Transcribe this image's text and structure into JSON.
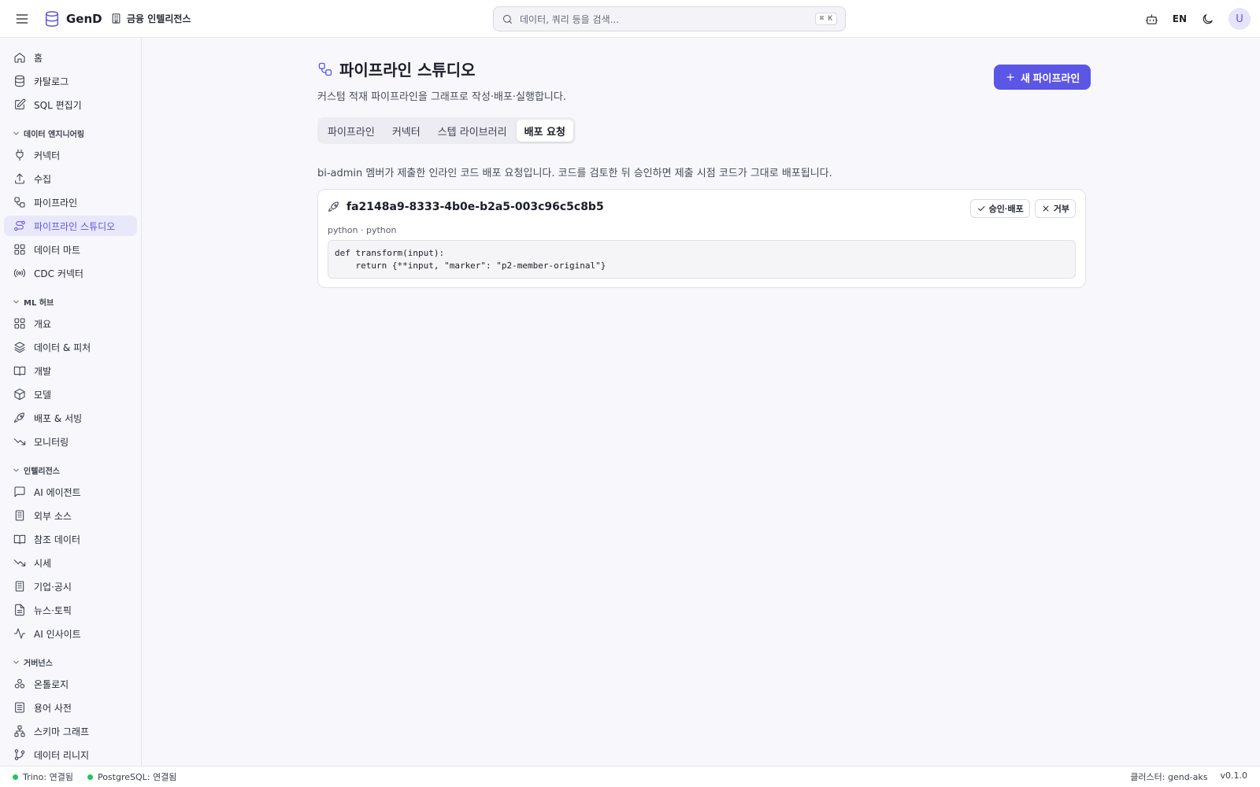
{
  "header": {
    "app_name": "GenD",
    "workspace": "금융 인텔리전스",
    "search_placeholder": "데이터, 쿼리 등을 검색...",
    "search_shortcut": "⌘ K",
    "lang": "EN",
    "avatar_initial": "U"
  },
  "sidebar": {
    "top_items": [
      {
        "label": "홈",
        "icon": "home-icon"
      },
      {
        "label": "카탈로그",
        "icon": "database-icon"
      },
      {
        "label": "SQL 편집기",
        "icon": "edit-icon"
      }
    ],
    "sections": [
      {
        "title": "데이터 엔지니어링",
        "items": [
          {
            "label": "커넥터",
            "icon": "plug-icon"
          },
          {
            "label": "수집",
            "icon": "upload-icon"
          },
          {
            "label": "파이프라인",
            "icon": "workflow-icon"
          },
          {
            "label": "파이프라인 스튜디오",
            "icon": "route-icon",
            "active": true
          },
          {
            "label": "데이터 마트",
            "icon": "grid-icon"
          },
          {
            "label": "CDC 커넥터",
            "icon": "radio-icon"
          }
        ]
      },
      {
        "title": "ML 허브",
        "items": [
          {
            "label": "개요",
            "icon": "grid-icon"
          },
          {
            "label": "데이터 & 피처",
            "icon": "layers-icon"
          },
          {
            "label": "개발",
            "icon": "book-icon"
          },
          {
            "label": "모델",
            "icon": "box-icon"
          },
          {
            "label": "배포 & 서빙",
            "icon": "rocket-icon"
          },
          {
            "label": "모니터링",
            "icon": "trend-down-icon"
          }
        ]
      },
      {
        "title": "인텔리전스",
        "items": [
          {
            "label": "AI 에이전트",
            "icon": "chat-icon"
          },
          {
            "label": "외부 소스",
            "icon": "building-icon"
          },
          {
            "label": "참조 데이터",
            "icon": "book-icon"
          },
          {
            "label": "시세",
            "icon": "trend-down-icon"
          },
          {
            "label": "기업·공시",
            "icon": "building-icon"
          },
          {
            "label": "뉴스·토픽",
            "icon": "file-icon"
          },
          {
            "label": "AI 인사이트",
            "icon": "activity-icon"
          }
        ]
      },
      {
        "title": "거버넌스",
        "items": [
          {
            "label": "온톨로지",
            "icon": "cubes-icon"
          },
          {
            "label": "용어 사전",
            "icon": "list-icon"
          },
          {
            "label": "스키마 그래프",
            "icon": "network-icon"
          },
          {
            "label": "데이터 리니지",
            "icon": "git-branch-icon"
          }
        ]
      }
    ]
  },
  "page": {
    "title": "파이프라인 스튜디오",
    "subtitle": "커스텀 적재 파이프라인을 그래프로 작성·배포·실행합니다.",
    "new_button": "새 파이프라인",
    "tabs": [
      {
        "label": "파이프라인"
      },
      {
        "label": "커넥터"
      },
      {
        "label": "스텝 라이브러리"
      },
      {
        "label": "배포 요청",
        "active": true
      }
    ],
    "intro": "bi-admin 멤버가 제출한 인라인 코드 배포 요청입니다. 코드를 검토한 뒤 승인하면 제출 시점 코드가 그대로 배포됩니다.",
    "request": {
      "id": "fa2148a9-8333-4b0e-b2a5-003c96c5c8b5",
      "approve_label": "승인·배포",
      "reject_label": "거부",
      "lang_meta": "python · python",
      "code": "def transform(input):\n    return {**input, \"marker\": \"p2-member-original\"}"
    }
  },
  "status": {
    "trino": "Trino: 연결됨",
    "postgres": "PostgreSQL: 연결됨",
    "cluster": "클러스터: gend-aks",
    "version": "v0.1.0"
  },
  "colors": {
    "accent": "#5b56e6",
    "connected": "#22c55e"
  }
}
